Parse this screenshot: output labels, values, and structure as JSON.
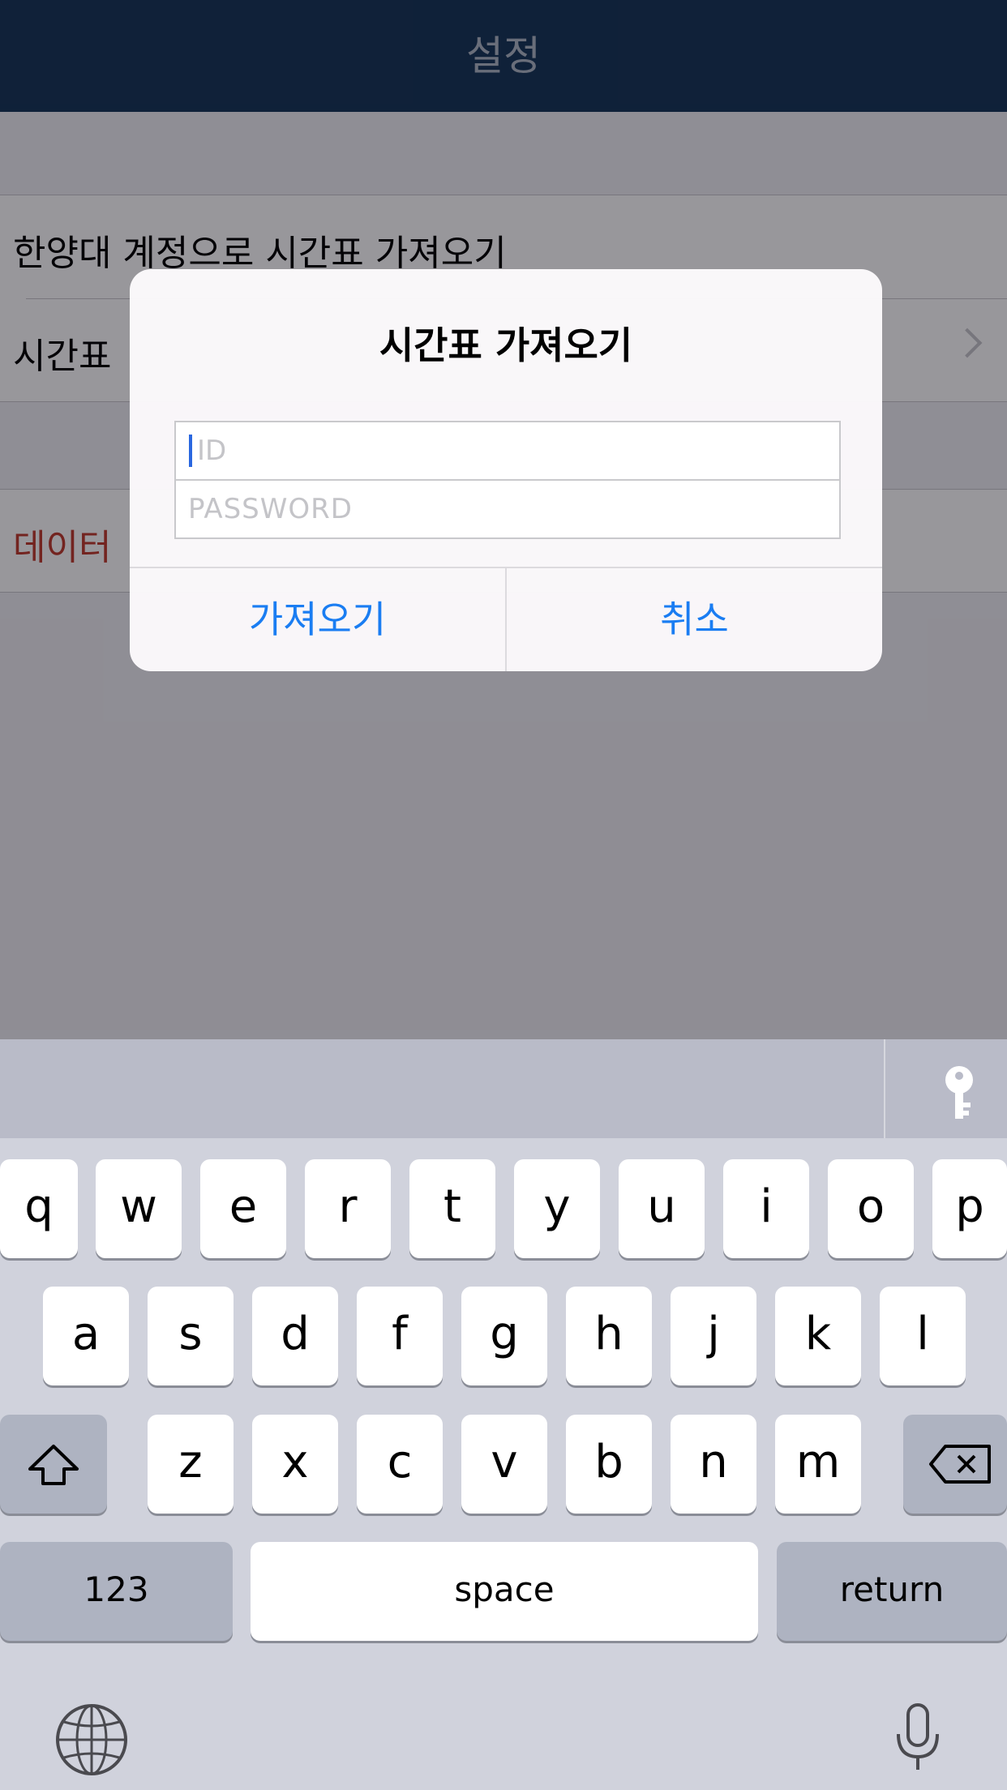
{
  "nav": {
    "title": "설정"
  },
  "settings": {
    "import_with_account": "한양대 계정으로 시간표 가져오기",
    "timetable_item_partial": "시간표",
    "data_item_partial": "데이터"
  },
  "alert": {
    "title": "시간표 가져오기",
    "id_placeholder": "ID",
    "password_placeholder": "PASSWORD",
    "confirm_label": "가져오기",
    "cancel_label": "취소"
  },
  "keyboard": {
    "row1": [
      "q",
      "w",
      "e",
      "r",
      "t",
      "y",
      "u",
      "i",
      "o",
      "p"
    ],
    "row2": [
      "a",
      "s",
      "d",
      "f",
      "g",
      "h",
      "j",
      "k",
      "l"
    ],
    "row3": [
      "z",
      "x",
      "c",
      "v",
      "b",
      "n",
      "m"
    ],
    "numbers_label": "123",
    "space_label": "space",
    "return_label": "return"
  },
  "colors": {
    "nav_bg": "#143457",
    "alert_button": "#1a7df2",
    "destructive": "#c0392b"
  }
}
